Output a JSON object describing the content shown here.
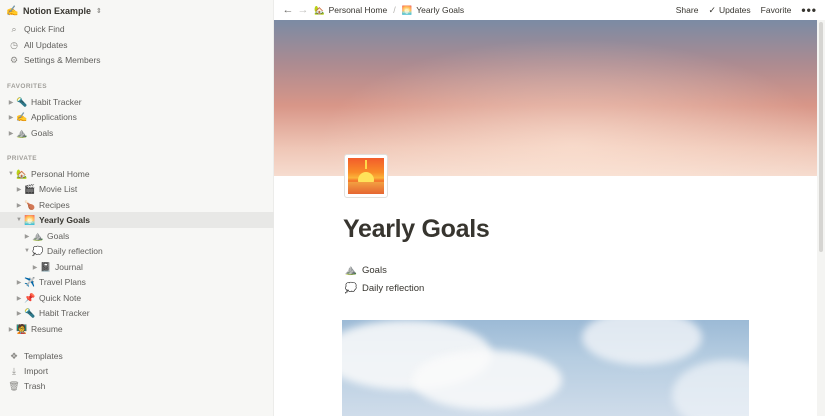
{
  "workspace": {
    "icon": "✍️",
    "name": "Notion Example",
    "switcher_icon": "chevron-updown-icon"
  },
  "utilities": [
    {
      "icon": "search-icon",
      "glyph": "⌕",
      "label": "Quick Find"
    },
    {
      "icon": "clock-icon",
      "glyph": "◷",
      "label": "All Updates"
    },
    {
      "icon": "gear-icon",
      "glyph": "⚙",
      "label": "Settings & Members"
    }
  ],
  "favorites": {
    "label": "FAVORITES",
    "items": [
      {
        "emoji": "🔦",
        "label": "Habit Tracker"
      },
      {
        "emoji": "✍️",
        "label": "Applications"
      },
      {
        "emoji": "⛰️",
        "label": "Goals"
      }
    ]
  },
  "private": {
    "label": "PRIVATE",
    "items": [
      {
        "emoji": "🏡",
        "label": "Personal Home",
        "expanded": true
      },
      {
        "emoji": "🎬",
        "label": "Movie List"
      },
      {
        "emoji": "🍗",
        "label": "Recipes"
      },
      {
        "emoji": "🌅",
        "label": "Yearly Goals",
        "expanded": true,
        "active": true
      },
      {
        "emoji": "⛰️",
        "label": "Goals"
      },
      {
        "emoji": "💭",
        "label": "Daily reflection",
        "expanded": true
      },
      {
        "emoji": "📓",
        "label": "Journal"
      },
      {
        "emoji": "✈️",
        "label": "Travel Plans"
      },
      {
        "emoji": "📌",
        "label": "Quick Note"
      },
      {
        "emoji": "🔦",
        "label": "Habit Tracker"
      },
      {
        "emoji": "🧑‍🏫",
        "label": "Resume"
      }
    ]
  },
  "bottom": [
    {
      "icon": "templates-icon",
      "glyph": "❖",
      "label": "Templates"
    },
    {
      "icon": "import-icon",
      "glyph": "⤓",
      "label": "Import"
    },
    {
      "icon": "trash-icon",
      "glyph": "🗑",
      "label": "Trash"
    }
  ],
  "topbar": {
    "back_icon": "←",
    "forward_icon": "→",
    "breadcrumbs": [
      {
        "emoji": "🏡",
        "label": "Personal Home"
      },
      {
        "emoji": "🌅",
        "label": "Yearly Goals"
      }
    ],
    "separator": "/",
    "share": "Share",
    "updates": "Updates",
    "favorite": "Favorite",
    "more": "•••"
  },
  "page": {
    "title": "Yearly Goals",
    "links": [
      {
        "emoji": "⛰️",
        "label": "Goals"
      },
      {
        "emoji": "💭",
        "label": "Daily reflection"
      }
    ]
  }
}
